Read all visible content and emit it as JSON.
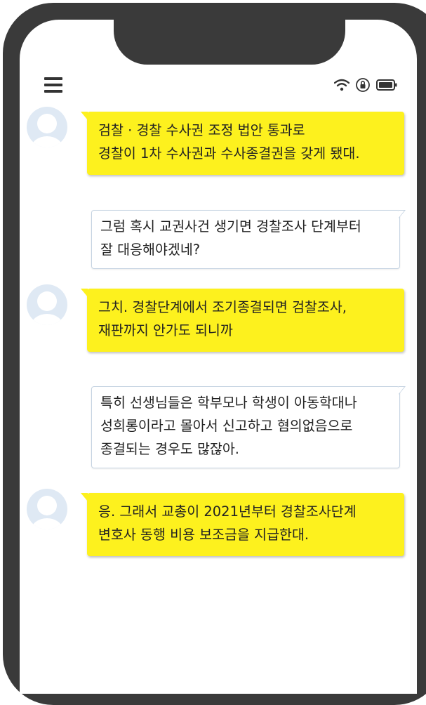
{
  "device": {
    "frame_color": "#3a3a3a",
    "screen_color": "#ffffff"
  },
  "header": {
    "menu_icon": "hamburger-menu-icon",
    "status_icons": [
      "wifi-icon",
      "lock-rotation-icon",
      "battery-icon"
    ]
  },
  "colors": {
    "incoming_bubble": "#fdf11e",
    "outgoing_bubble": "#ffffff",
    "outgoing_border": "#c6d4e2",
    "avatar_bg": "#dfe9f4",
    "avatar_fg": "#ffffff"
  },
  "messages": [
    {
      "sender": "them",
      "text": "검찰 · 경찰 수사권 조정 법안 통과로\n경찰이 1차 수사권과 수사종결권을 갖게 됐대."
    },
    {
      "sender": "me",
      "text": "그럼 혹시 교권사건 생기면 경찰조사 단계부터\n잘 대응해야겠네?"
    },
    {
      "sender": "them",
      "text": "그치. 경찰단계에서 조기종결되면 검찰조사,\n재판까지 안가도 되니까"
    },
    {
      "sender": "me",
      "text": "특히 선생님들은 학부모나 학생이 아동학대나\n성희롱이라고 몰아서 신고하고 혐의없음으로\n종결되는 경우도 많잖아."
    },
    {
      "sender": "them",
      "text": "응. 그래서 교총이 2021년부터 경찰조사단계\n변호사 동행 비용 보조금을 지급한대."
    }
  ]
}
